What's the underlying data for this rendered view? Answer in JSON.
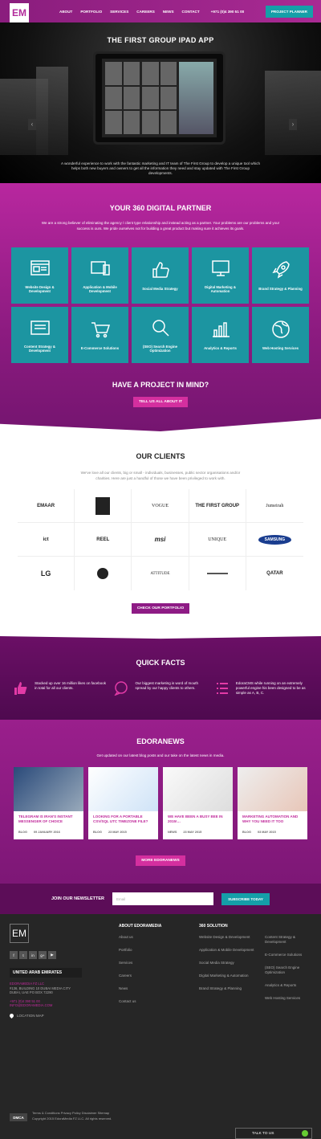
{
  "header": {
    "logo": "EM",
    "nav": [
      "ABOUT",
      "PORTFOLIO",
      "SERVICES",
      "CAREERS",
      "NEWS",
      "CONTACT"
    ],
    "phone": "+971 (0)4 390 51 00",
    "cta": "PROJECT PLANNER"
  },
  "hero": {
    "title": "THE FIRST GROUP IPAD APP",
    "text": "A wonderful experience to work with the fantastic marketing and IT team of The First Group to develop a unique tool which helps both new buyers and owners to get all the information they need and stay updated with The First Group developments.",
    "left_arrow": "‹",
    "right_arrow": "›"
  },
  "partner": {
    "title": "YOUR 360 DIGITAL PARTNER",
    "text": "We are a strong believer of eliminating the agency / client type relationship and instead acting as a partner. Your problems are our problems and your success is ours. We pride ourselves not for building a great product but making sure it achieves its goals.",
    "tiles": [
      "Website Design & Development",
      "Application & Mobile Development",
      "Social Media Strategy",
      "Digital Marketing & Automation",
      "Brand Strategy & Planning",
      "Content Strategy & Development",
      "E-Commerce Solutions",
      "(SEO) Search Engine Optimization",
      "Analytics & Reports",
      "Web Hosting Services"
    ],
    "project_title": "HAVE A PROJECT IN MIND?",
    "project_button": "TELL US ALL ABOUT IT"
  },
  "clients": {
    "title": "OUR CLIENTS",
    "text": "We've love all our clients, big or small - individuals, businesses, public sector organisations and/or charities. Here are just a handful of those we have been privileged to work with.",
    "logos": [
      "EMAAR",
      "",
      "VOGUE",
      "THE FIRST GROUP",
      "Jumeirah",
      "ict",
      "REEL",
      "msi",
      "UNIQUE",
      "SAMSUNG",
      "LG",
      "",
      "ATTITUDE",
      "",
      "QATAR"
    ],
    "button": "CHECK OUR PORTFOLIO"
  },
  "facts": {
    "title": "QUICK FACTS",
    "items": [
      "Stacked up over 16 million likes on facebook in total for all our clients.",
      "Our biggest marketing is word of mouth spread by our happy clients to others.",
      "EdoraCMS while running on an extremely powerful engine his been designed to be as simple as A, B, C."
    ]
  },
  "news": {
    "title": "EDORANEWS",
    "sub": "Get updated on our latest blog posts and our take on the latest news in media.",
    "cards": [
      {
        "title": "TELEGRAM IS IRAN'S INSTANT MESSENGER OF CHOICE",
        "tag": "BLOG",
        "date": "09 JANUARY 2016"
      },
      {
        "title": "LOOKING FOR A PORTABLE CSV/SQL UTC TIMEZONE FILE?",
        "tag": "BLOG",
        "date": "23 MAY 2015"
      },
      {
        "title": "WE HAVE BEEN A BUSY BEE IN 2015!…",
        "tag": "NEWS",
        "date": "23 MAY 2015"
      },
      {
        "title": "MARKETING AUTOMATION AND WHY YOU NEED IT TOO",
        "tag": "BLOG",
        "date": "03 MAY 2015"
      }
    ],
    "button": "MORE EDORANEWS"
  },
  "newsletter": {
    "label": "JOIN OUR NEWSLETTER",
    "placeholder": "Email",
    "button": "SUBSCRIBE TODAY"
  },
  "footer": {
    "logo": "EM",
    "social": [
      "f",
      "t",
      "in",
      "g+",
      "▶"
    ],
    "country": "UNITED ARAB EMIRATES",
    "address": [
      "EDORAMEDIA FZ LLC",
      "#136, BUILDING 10 DUBAI MEDIA CITY",
      "DUBAI, UAE PO BOX 72290"
    ],
    "contact": [
      "+971 (0)4 390 51 00",
      "INFO@EDORAMEDIA.COM"
    ],
    "map": "LOCATION MAP",
    "about_title": "ABOUT EDORAMEDIA",
    "about": [
      "About us",
      "Portfolio",
      "Services",
      "Careers",
      "News",
      "Contact us"
    ],
    "solution_title": "360 SOLUTION",
    "solutions1": [
      "Website Design & Development",
      "Application & Mobile Development",
      "Social Media Strategy",
      "Digital Marketing & Automation",
      "Brand Strategy & Planning"
    ],
    "solutions2": [
      "Content Strategy & Development",
      "E-Commerce Solutions",
      "(SEO) Search Engine Optimization",
      "Analytics & Reports",
      "Web Hosting Services"
    ],
    "legal": "Terms & Conditions   Privacy Policy   Disclaimer   Sitemap",
    "dmca": "DMCA",
    "copyright": "Copyright 2015 EdoraMedia FZ LLC. All rights reserved.",
    "talk": "TALK TO US"
  }
}
